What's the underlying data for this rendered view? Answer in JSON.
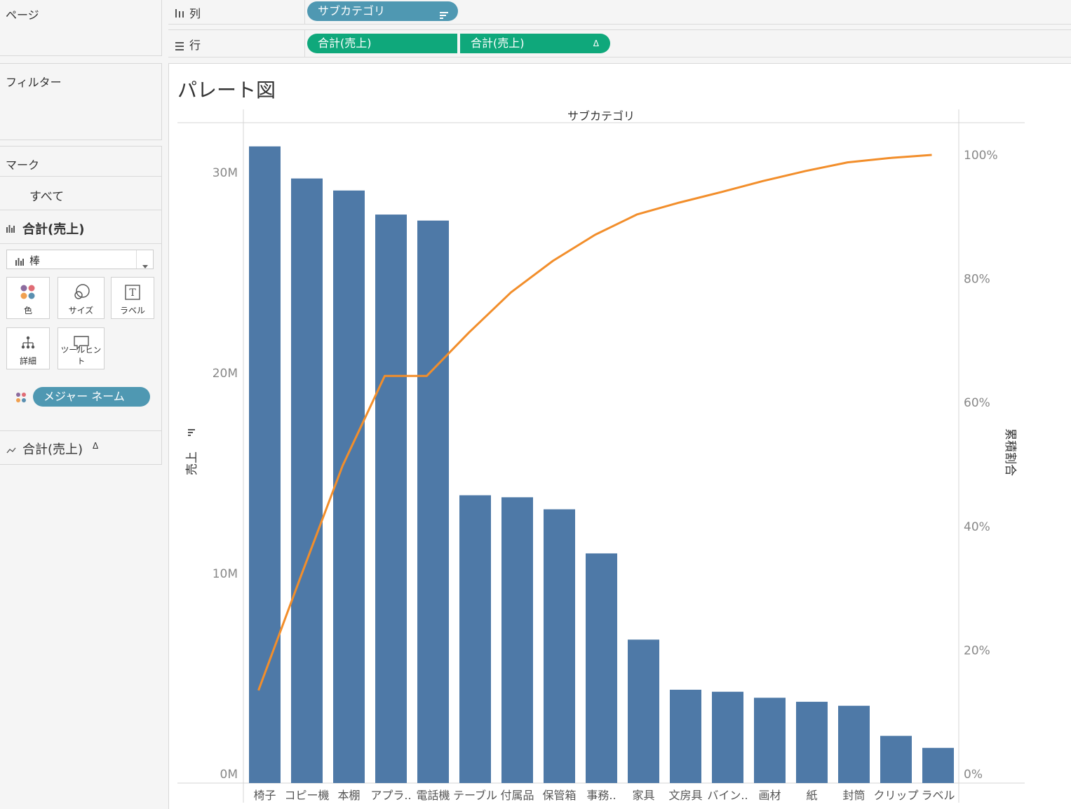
{
  "pages_label": "ページ",
  "filters_label": "フィルター",
  "marks": {
    "label": "マーク",
    "all_label": "すべて",
    "measure1_label": "合計(売上)",
    "mark_type": "棒",
    "cards": [
      {
        "label": "色",
        "icon": "color-dots-icon"
      },
      {
        "label": "サイズ",
        "icon": "size-circles-icon"
      },
      {
        "label": "ラベル",
        "icon": "text-T-icon"
      },
      {
        "label": "詳細",
        "icon": "detail-tree-icon"
      },
      {
        "label": "ツールヒント",
        "icon": "tooltip-bubble-icon"
      }
    ],
    "color_pill": "メジャー ネーム",
    "measure2_label": "合計(売上)",
    "measure2_delta": "Δ"
  },
  "shelves": {
    "columns": {
      "name": "列",
      "pill": "サブカテゴリ"
    },
    "rows": {
      "name": "行",
      "pill1": "合計(売上)",
      "pill2": "合計(売上)",
      "pill2_delta": "Δ"
    }
  },
  "colors": {
    "bar": "#4e79a7",
    "line": "#f28e2b",
    "pill_blue": "#4f98b2",
    "pill_green": "#0fa87b"
  },
  "chart_data": {
    "type": "bar",
    "title": "パレート図",
    "column_header": "サブカテゴリ",
    "ylabel": "売上",
    "y2label": "累積割合",
    "ylim": [
      0,
      32.5
    ],
    "y_ticks": [
      {
        "v": 0,
        "label": "0M"
      },
      {
        "v": 10,
        "label": "10M"
      },
      {
        "v": 20,
        "label": "20M"
      },
      {
        "v": 30,
        "label": "30M"
      }
    ],
    "y2lim": [
      0,
      100
    ],
    "y2_ticks": [
      {
        "v": 0,
        "label": "0%"
      },
      {
        "v": 20,
        "label": "20%"
      },
      {
        "v": 40,
        "label": "40%"
      },
      {
        "v": 60,
        "label": "60%"
      },
      {
        "v": 80,
        "label": "80%"
      },
      {
        "v": 100,
        "label": "100%"
      }
    ],
    "categories": [
      "椅子",
      "コピー機",
      "本棚",
      "アプラ..",
      "電話機",
      "テーブル",
      "付属品",
      "保管箱",
      "事務..",
      "家具",
      "文房具",
      "バイン..",
      "画材",
      "紙",
      "封筒",
      "クリップ",
      "ラベル"
    ],
    "series": [
      {
        "values": [
          31.3,
          29.7,
          29.1,
          27.9,
          27.6,
          13.9,
          13.8,
          13.2,
          11.0,
          6.7,
          4.2,
          4.1,
          3.8,
          3.6,
          3.4,
          1.9,
          1.3
        ]
      },
      {
        "type": "line",
        "values": [
          13.5,
          31.8,
          49.8,
          64.3,
          64.3,
          71.3,
          77.8,
          82.9,
          87.1,
          90.4,
          92.3,
          94.0,
          95.8,
          97.4,
          98.8,
          99.5,
          100.0
        ]
      }
    ]
  }
}
